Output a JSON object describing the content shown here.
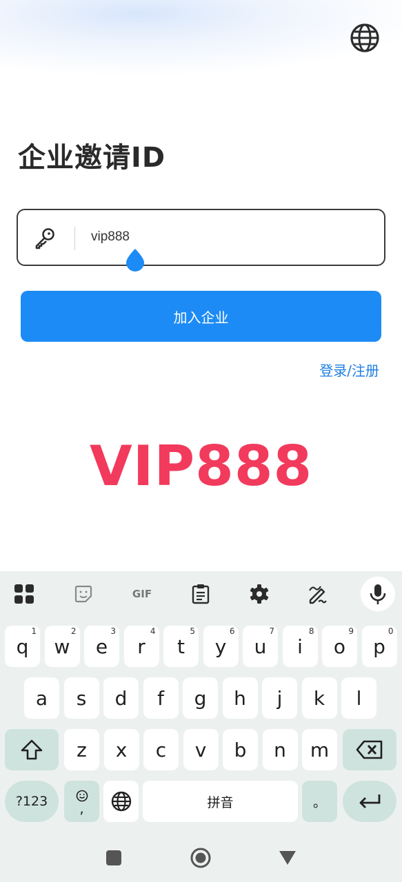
{
  "header": {
    "language_icon": "globe-icon"
  },
  "page": {
    "title": "企业邀请ID"
  },
  "invite_input": {
    "value": "vip888",
    "icon": "key-icon"
  },
  "join_button": {
    "label": "加入企业"
  },
  "login_link": {
    "label": "登录/注册"
  },
  "watermark": {
    "text": "VIP888",
    "color": "#f23a5c"
  },
  "colors": {
    "primary": "#1d8bf5",
    "link": "#1d7fe0",
    "keyboard_bg": "#ecf1ef",
    "function_key": "#cfe3de"
  },
  "keyboard": {
    "toolbar": {
      "apps_icon": "apps-grid-icon",
      "sticker_icon": "sticker-icon",
      "gif_label": "GIF",
      "clipboard_icon": "clipboard-icon",
      "settings_icon": "gear-icon",
      "handwriting_icon": "handwriting-icon",
      "mic_icon": "microphone-icon"
    },
    "row1": [
      {
        "key": "q",
        "hint": "1"
      },
      {
        "key": "w",
        "hint": "2"
      },
      {
        "key": "e",
        "hint": "3"
      },
      {
        "key": "r",
        "hint": "4"
      },
      {
        "key": "t",
        "hint": "5"
      },
      {
        "key": "y",
        "hint": "6"
      },
      {
        "key": "u",
        "hint": "7"
      },
      {
        "key": "i",
        "hint": "8"
      },
      {
        "key": "o",
        "hint": "9"
      },
      {
        "key": "p",
        "hint": "0"
      }
    ],
    "row2": [
      "a",
      "s",
      "d",
      "f",
      "g",
      "h",
      "j",
      "k",
      "l"
    ],
    "row3": [
      "z",
      "x",
      "c",
      "v",
      "b",
      "n",
      "m"
    ],
    "symbols_key": "?123",
    "emoji_comma_key": ",",
    "space_key": "拼音",
    "period_key": "。",
    "shift_icon": "shift-icon",
    "backspace_icon": "backspace-icon",
    "enter_icon": "enter-icon",
    "globe_key_icon": "globe-icon"
  },
  "navigation": {
    "recents_icon": "square-icon",
    "home_icon": "circle-icon",
    "back_icon": "triangle-back-icon"
  }
}
